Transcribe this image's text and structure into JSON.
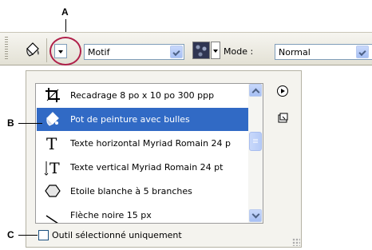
{
  "callouts": {
    "a": "A",
    "b": "B",
    "c": "C"
  },
  "options_bar": {
    "preset_value": "Motif",
    "mode_label": "Mode :",
    "mode_value": "Normal"
  },
  "preset_panel": {
    "items": [
      {
        "label": "Recadrage 8 po x 10 po 300 ppp",
        "icon": "crop-icon",
        "selected": false
      },
      {
        "label": "Pot de peinture avec bulles",
        "icon": "paint-bucket-icon",
        "selected": true
      },
      {
        "label": "Texte horizontal Myriad Romain 24 p",
        "icon": "horizontal-type-icon",
        "selected": false
      },
      {
        "label": "Texte vertical Myriad Romain 24 pt",
        "icon": "vertical-type-icon",
        "selected": false
      },
      {
        "label": "Etoile blanche à 5 branches",
        "icon": "polygon-icon",
        "selected": false
      },
      {
        "label": "Flèche noire 15 px",
        "icon": "line-icon",
        "selected": false
      }
    ],
    "current_tool_only_label": "Outil sélectionné uniquement",
    "current_tool_only_checked": false
  },
  "colors": {
    "selection": "#316ac5",
    "callout_circle": "#b0204a"
  }
}
